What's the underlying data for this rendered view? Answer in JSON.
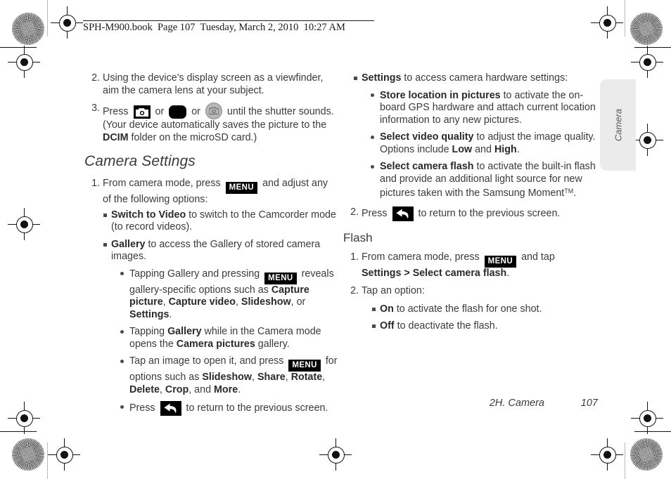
{
  "header": {
    "book_line": "SPH-M900.book  Page 107  Tuesday, March 2, 2010  10:27 AM"
  },
  "side_tab": {
    "label": "Camera"
  },
  "footer": {
    "chapter": "2H. Camera",
    "page_number": "107"
  },
  "icons": {
    "camera_square": "camera-square-icon",
    "shutter_button": "shutter-round-button-icon",
    "camera_circle": "camera-circle-icon",
    "menu_key": "MENU",
    "back_key": "back-arrow-icon"
  },
  "left_column": {
    "step2": {
      "marker": "2.",
      "text": "Using the device's display screen as a viewfinder, aim the camera lens at your subject."
    },
    "step3": {
      "marker": "3.",
      "lead": "Press",
      "or1": "or",
      "or2": "or",
      "tail_a": "until the shutter sounds. (Your device automatically saves the picture to the ",
      "tail_bold": "DCIM",
      "tail_b": " folder on the microSD card.)"
    },
    "section_heading": "Camera Settings",
    "step1": {
      "marker": "1.",
      "lead": "From camera mode, press",
      "tail": "and adjust any of the following options:"
    },
    "bullets": [
      {
        "bold": "Switch to Video",
        "text": " to switch to the Camcorder mode (to record videos)."
      },
      {
        "bold": "Gallery",
        "text": " to access the Gallery of stored camera images."
      }
    ],
    "sub_bullets": [
      {
        "lead": "Tapping Gallery and pressing",
        "mid": "reveals gallery-specific options such as ",
        "bold1": "Capture picture",
        "sep1": ", ",
        "bold2": "Capture video",
        "sep2": ", ",
        "bold3": "Slideshow",
        "sep3": ", or ",
        "bold4": "Settings",
        "end": "."
      },
      {
        "pre": "Tapping ",
        "bold1": "Gallery",
        "mid": " while in the Camera mode opens the ",
        "bold2": "Camera pictures",
        "end": " gallery."
      },
      {
        "lead": "Tap an image to open it, and press",
        "mid": "for options such as ",
        "bold1": "Slideshow",
        "sep1": ", ",
        "bold2": "Share",
        "sep2": ", ",
        "bold3": "Rotate",
        "sep3": ", ",
        "bold4": "Delete",
        "sep4": ", ",
        "bold5": "Crop",
        "sep5": ", and ",
        "bold6": "More",
        "end": "."
      },
      {
        "lead": "Press",
        "tail": "to return to the previous screen."
      }
    ]
  },
  "right_column": {
    "settings_bullet": {
      "bold": "Settings",
      "text": " to access camera hardware settings:"
    },
    "settings_sub": [
      {
        "bold": "Store location in pictures",
        "text": " to activate the on-board GPS hardware and attach current location information to any new pictures."
      },
      {
        "bold": "Select video quality",
        "text": " to adjust the image quality. Options include ",
        "bold2": "Low",
        "text2": " and ",
        "bold3": "High",
        "end": "."
      },
      {
        "bold": "Select camera flash",
        "text": " to activate the built-in flash and provide an additional light source for new pictures taken with the Samsung Moment",
        "tm": "TM",
        "end": "."
      }
    ],
    "step2": {
      "marker": "2.",
      "lead": "Press",
      "tail": "to return to the previous screen."
    },
    "flash_heading": "Flash",
    "flash_step1": {
      "marker": "1.",
      "lead": "From camera mode, press",
      "mid": "and tap",
      "bold": "Settings > Select camera flash",
      "end": "."
    },
    "flash_step2": {
      "marker": "2.",
      "text": "Tap an option:"
    },
    "flash_options": [
      {
        "bold": "On",
        "text": " to activate the flash for one shot."
      },
      {
        "bold": "Off",
        "text": " to deactivate the flash."
      }
    ]
  }
}
